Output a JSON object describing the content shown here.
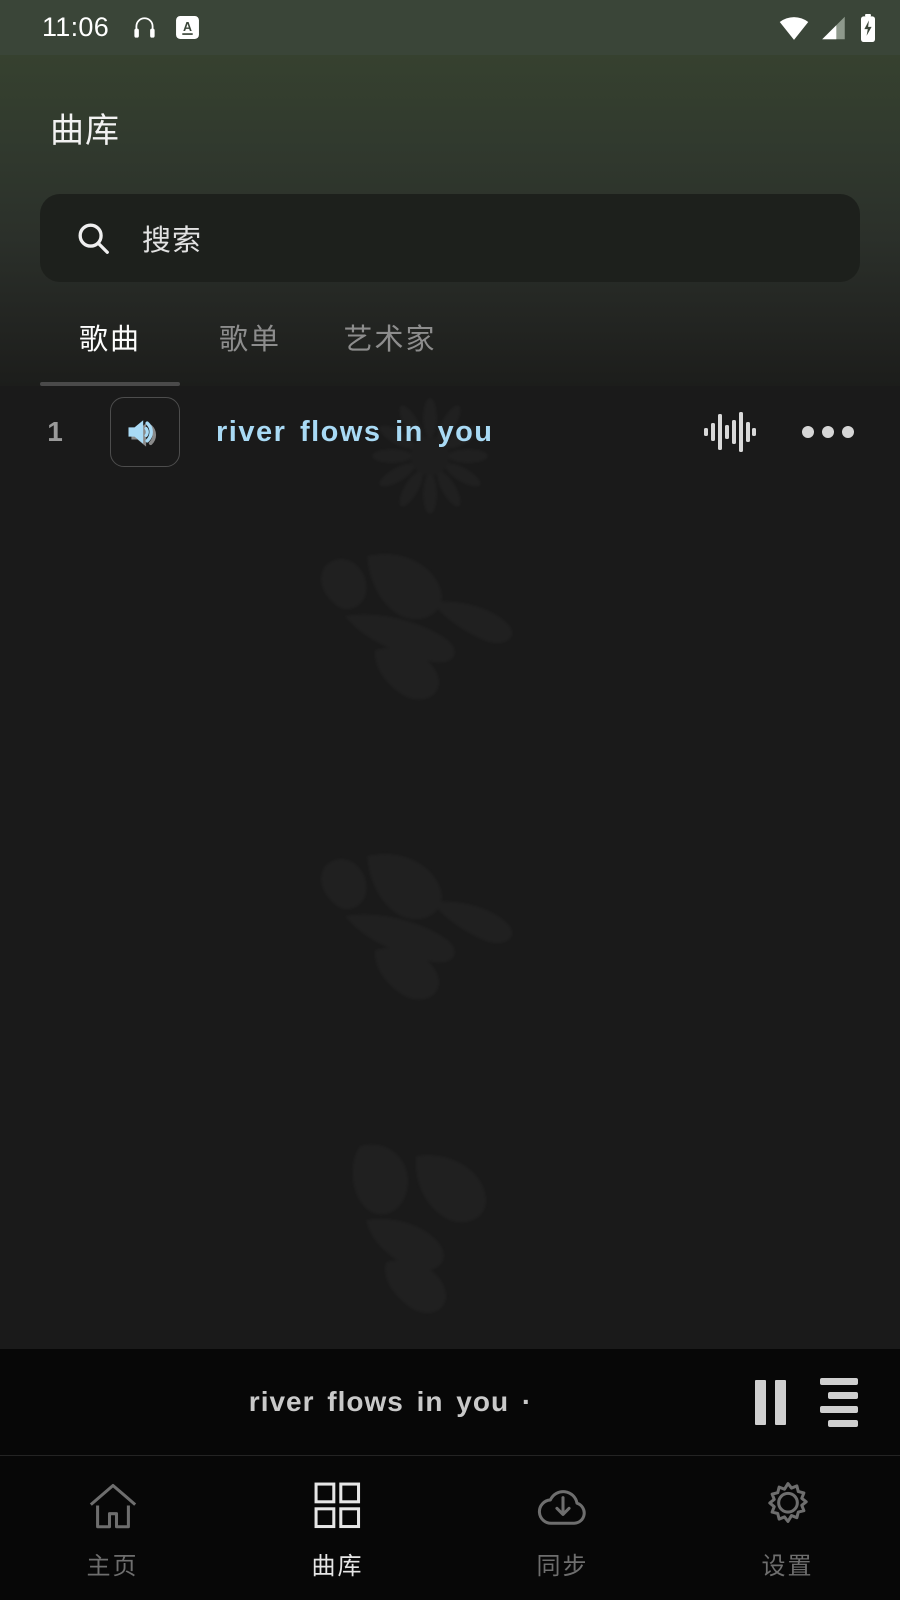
{
  "status_bar": {
    "time": "11:06",
    "left_icons": [
      "headphones-icon",
      "input-method-a-icon"
    ],
    "right_icons": [
      "wifi-icon",
      "cellular-signal-icon",
      "battery-charging-icon"
    ]
  },
  "header": {
    "title": "曲库"
  },
  "search": {
    "placeholder": "搜索",
    "icon": "search-icon",
    "value": ""
  },
  "tabs": [
    {
      "label": "歌曲",
      "active": true
    },
    {
      "label": "歌单",
      "active": false
    },
    {
      "label": "艺术家",
      "active": false
    }
  ],
  "tracks": [
    {
      "index": "1",
      "title": "river flows in you",
      "art_icon": "speaker-playing-icon",
      "playing_icon": "equalizer-waveform-icon",
      "more_icon": "more-horizontal-icon",
      "is_playing": true
    }
  ],
  "mini_player": {
    "title": "river flows in you ·",
    "pause_icon": "pause-icon",
    "queue_icon": "queue-list-icon"
  },
  "bottom_nav": [
    {
      "label": "主页",
      "icon": "home-icon",
      "active": false
    },
    {
      "label": "曲库",
      "icon": "grid-library-icon",
      "active": true
    },
    {
      "label": "同步",
      "icon": "cloud-download-icon",
      "active": false
    },
    {
      "label": "设置",
      "icon": "gear-icon",
      "active": false
    }
  ],
  "colors": {
    "status_bar_bg": "#3a4538",
    "header_gradient_top": "#36412f",
    "content_bg": "#1a1a1a",
    "search_bg": "#1d201c",
    "track_title_accent": "#a9daf5",
    "nav_bg": "#070707",
    "nav_active_text": "#e6e6e6",
    "nav_inactive_text": "#6e6e6e"
  }
}
